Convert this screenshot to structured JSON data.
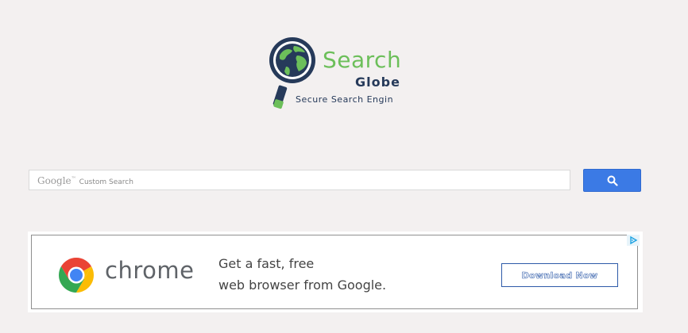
{
  "logo": {
    "word1": "Search",
    "word2": "Globe",
    "tagline": "Secure Search Engin"
  },
  "search": {
    "watermark_brand": "Google",
    "watermark_tm": "™",
    "watermark_label": "Custom Search",
    "value": "",
    "button_icon": "search-icon"
  },
  "ad": {
    "brand": "chrome",
    "line1": "Get a fast, free",
    "line2": "web browser from Google.",
    "cta": "Download Now",
    "adchoices_icon": "adchoices-icon"
  },
  "colors": {
    "background": "#f3f0f0",
    "search_button": "#3b7ae5",
    "logo_green": "#6cbf5a",
    "logo_navy": "#263a5a",
    "cta_border": "#2d5aa8"
  }
}
